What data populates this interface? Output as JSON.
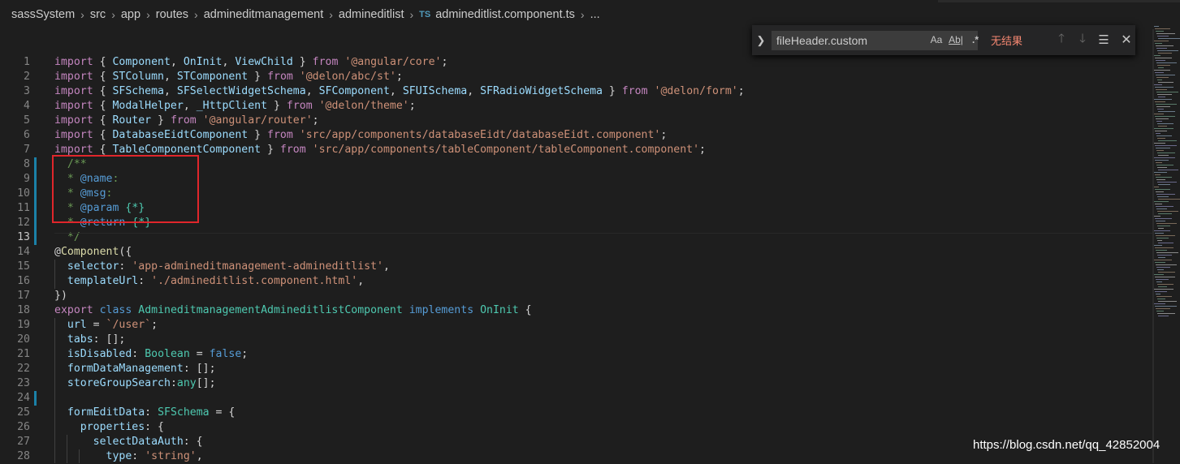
{
  "breadcrumb": {
    "items": [
      "sassSystem",
      "src",
      "app",
      "routes",
      "admineditmanagement",
      "admineditlist"
    ],
    "file_badge": "TS",
    "file": "admineditlist.component.ts",
    "more": "..."
  },
  "find_widget": {
    "query": "fileHeader.custom",
    "match_case_label": "Aa",
    "whole_word_label": "Ab|",
    "regex_label": ".*",
    "result_text": "无结果"
  },
  "editor": {
    "active_line": 13,
    "lines": [
      {
        "n": 1,
        "html": "<span class=\"k-imp\">import</span> { <span class=\"v\">Component</span>, <span class=\"v\">OnInit</span>, <span class=\"v\">ViewChild</span> } <span class=\"k-imp\">from</span> <span class=\"s\">'@angular/core'</span>;"
      },
      {
        "n": 2,
        "html": "<span class=\"k-imp\">import</span> { <span class=\"v\">STColumn</span>, <span class=\"v\">STComponent</span> } <span class=\"k-imp\">from</span> <span class=\"s\">'@delon/abc/st'</span>;"
      },
      {
        "n": 3,
        "html": "<span class=\"k-imp\">import</span> { <span class=\"v\">SFSchema</span>, <span class=\"v\">SFSelectWidgetSchema</span>, <span class=\"v\">SFComponent</span>, <span class=\"v\">SFUISchema</span>, <span class=\"v\">SFRadioWidgetSchema</span> } <span class=\"k-imp\">from</span> <span class=\"s\">'@delon/form'</span>;"
      },
      {
        "n": 4,
        "html": "<span class=\"k-imp\">import</span> { <span class=\"v\">ModalHelper</span>, <span class=\"v\">_HttpClient</span> } <span class=\"k-imp\">from</span> <span class=\"s\">'@delon/theme'</span>;"
      },
      {
        "n": 5,
        "html": "<span class=\"k-imp\">import</span> { <span class=\"v\">Router</span> } <span class=\"k-imp\">from</span> <span class=\"s\">'@angular/router'</span>;"
      },
      {
        "n": 6,
        "html": "<span class=\"k-imp\">import</span> { <span class=\"v\">DatabaseEidtComponent</span> } <span class=\"k-imp\">from</span> <span class=\"s\">'src/app/components/databaseEidt/databaseEidt.component'</span>;"
      },
      {
        "n": 7,
        "html": "<span class=\"k-imp\">import</span> { <span class=\"v\">TableComponentComponent</span> } <span class=\"k-imp\">from</span> <span class=\"s\">'src/app/components/tableComponent/tableComponent.component'</span>;"
      },
      {
        "n": 8,
        "html": "  <span class=\"c\">/**</span>",
        "mod": true
      },
      {
        "n": 9,
        "html": "  <span class=\"c\">* </span><span class=\"ct\">@name</span><span class=\"c\">:</span>",
        "mod": true
      },
      {
        "n": 10,
        "html": "  <span class=\"c\">* </span><span class=\"ct\">@msg</span><span class=\"c\">:</span>",
        "mod": true
      },
      {
        "n": 11,
        "html": "  <span class=\"c\">* </span><span class=\"ct\">@param</span><span class=\"c\"> </span><span class=\"t\">{*}</span>",
        "mod": true
      },
      {
        "n": 12,
        "html": "  <span class=\"c\">* </span><span class=\"ct\">@return</span><span class=\"c\"> </span><span class=\"t\">{*}</span>",
        "mod": true
      },
      {
        "n": 13,
        "html": "  <span class=\"c\">*/</span>",
        "mod": true
      },
      {
        "n": 14,
        "html": "@<span class=\"f\">Component</span>({"
      },
      {
        "n": 15,
        "html": "  <span class=\"v\">selector</span>: <span class=\"s\">'app-admineditmanagement-admineditlist'</span>,"
      },
      {
        "n": 16,
        "html": "  <span class=\"v\">templateUrl</span>: <span class=\"s\">'./admineditlist.component.html'</span>,"
      },
      {
        "n": 17,
        "html": "})"
      },
      {
        "n": 18,
        "html": "<span class=\"k-imp\">export</span> <span class=\"k\">class</span> <span class=\"t\">AdmineditmanagementAdmineditlistComponent</span> <span class=\"k\">implements</span> <span class=\"t\">OnInit</span> {"
      },
      {
        "n": 19,
        "html": "  <span class=\"v\">url</span> = <span class=\"s\">`/user`</span>;"
      },
      {
        "n": 20,
        "html": "  <span class=\"v\">tabs</span>: [];"
      },
      {
        "n": 21,
        "html": "  <span class=\"v\">isDisabled</span>: <span class=\"t\">Boolean</span> = <span class=\"k\">false</span>;"
      },
      {
        "n": 22,
        "html": "  <span class=\"v\">formDataManagement</span>: [];"
      },
      {
        "n": 23,
        "html": "  <span class=\"v\">storeGroupSearch</span>:<span class=\"t\">any</span>[];"
      },
      {
        "n": 24,
        "html": "",
        "mod": true
      },
      {
        "n": 25,
        "html": "  <span class=\"v\">formEditData</span>: <span class=\"t\">SFSchema</span> = {"
      },
      {
        "n": 26,
        "html": "    <span class=\"v\">properties</span>: {"
      },
      {
        "n": 27,
        "html": "      <span class=\"v\">selectDataAuth</span>: {"
      },
      {
        "n": 28,
        "html": "        <span class=\"v\">type</span>: <span class=\"s\">'string'</span>,"
      }
    ]
  },
  "watermark": "https://blog.csdn.net/qq_42852004"
}
